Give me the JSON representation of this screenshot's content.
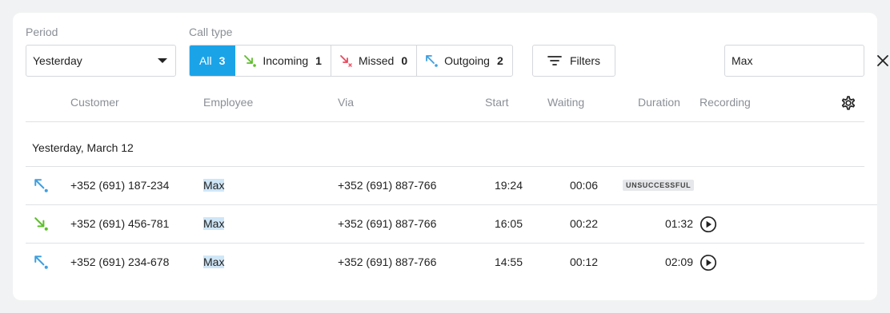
{
  "filters": {
    "period_label": "Period",
    "period_value": "Yesterday",
    "call_type_label": "Call type",
    "call_types": [
      {
        "label": "All",
        "count": "3"
      },
      {
        "label": "Incoming",
        "count": "1"
      },
      {
        "label": "Missed",
        "count": "0"
      },
      {
        "label": "Outgoing",
        "count": "2"
      }
    ],
    "filters_button": "Filters",
    "search_value": "Max"
  },
  "columns": [
    "Customer",
    "Employee",
    "Via",
    "Start",
    "Waiting",
    "Duration",
    "Recording"
  ],
  "group": {
    "title": "Yesterday, March 12"
  },
  "rows": [
    {
      "direction": "outgoing",
      "customer": "+352 (691) 187-234",
      "employee": "Max",
      "via": "+352 (691) 887-766",
      "start": "19:24",
      "waiting": "00:06",
      "status": "UNSUCCESSFUL"
    },
    {
      "direction": "incoming",
      "customer": "+352 (691) 456-781",
      "employee": "Max",
      "via": "+352 (691) 887-766",
      "start": "16:05",
      "waiting": "00:22",
      "duration": "01:32"
    },
    {
      "direction": "outgoing",
      "customer": "+352 (691) 234-678",
      "employee": "Max",
      "via": "+352 (691) 887-766",
      "start": "14:55",
      "waiting": "00:12",
      "duration": "02:09"
    }
  ],
  "icons": {
    "incoming": "arrow-down-right-icon",
    "missed": "missed-call-icon",
    "outgoing": "arrow-up-left-icon",
    "filters": "filter-lines-icon",
    "clear": "close-icon",
    "settings": "gear-icon",
    "play": "play-circle-icon"
  },
  "colors": {
    "accent": "#1ba3e8",
    "incoming": "#5cbf2a",
    "missed": "#e8495e",
    "outgoing": "#3f9fe0",
    "highlight": "#cfe6f7"
  }
}
